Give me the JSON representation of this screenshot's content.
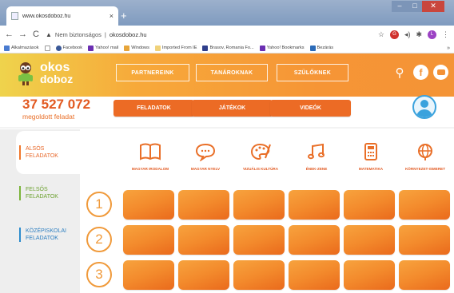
{
  "browser": {
    "tab_title": "www.okosdoboz.hu",
    "tab_close": "×",
    "new_tab": "+",
    "window_min": "–",
    "window_max": "□",
    "window_close": "✕",
    "back_icon": "←",
    "forward_icon": "→",
    "reload_icon": "C",
    "security_warning": "Nem biztonságos",
    "url": "okosdoboz.hu",
    "star_icon": "☆",
    "profile_g": "G",
    "profile_l": "L",
    "menu_icon": "⋮",
    "bookmarks": [
      {
        "label": "Alkalmazások",
        "color": "#4a7bd0"
      },
      {
        "label": "Facebook",
        "color": "#3b5998"
      },
      {
        "label": "Yahoo! mail",
        "color": "#6b2fb2"
      },
      {
        "label": "Windows",
        "color": "#e7a53a"
      },
      {
        "label": "Imported From IE",
        "color": "#f0d27a"
      },
      {
        "label": "Brasov, Romania Fo...",
        "color": "#2f3f8c"
      },
      {
        "label": "Yahoo! Bookmarks",
        "color": "#6b2fb2"
      },
      {
        "label": "Bezárás",
        "color": "#2b6bb8"
      }
    ],
    "bookmarks_more": "»"
  },
  "site": {
    "logo_line1": "okos",
    "logo_line2": "doboz",
    "nav": [
      "PARTNEREINK",
      "TANÁROKNAK",
      "SZÜLŐKNEK"
    ],
    "counter_number": "37 527 072",
    "counter_label": "megoldott feladat",
    "tabs": [
      "FELADATOK",
      "JÁTÉKOK",
      "VIDEÓK"
    ],
    "sidebar": [
      "ALSÓS FELADATOK",
      "FELSŐS FELADATOK",
      "KÖZÉPISKOLAI FELADATOK"
    ],
    "subjects": [
      {
        "label": "MAGYAR IRODALOM",
        "icon": "book-icon"
      },
      {
        "label": "MAGYAR NYELV",
        "icon": "speech-bubble-icon"
      },
      {
        "label": "VIZUÁLIS KULTÚRA",
        "icon": "palette-icon"
      },
      {
        "label": "ÉNEK-ZENE",
        "icon": "music-note-icon"
      },
      {
        "label": "MATEMATIKA",
        "icon": "calculator-icon"
      },
      {
        "label": "KÖRNYEZET-ISMERET",
        "icon": "globe-icon"
      }
    ],
    "grades": [
      "1",
      "2",
      "3"
    ],
    "colors": {
      "orange": "#ec6b25",
      "header_start": "#efd34c",
      "header_end": "#f49436",
      "blue": "#2c8ccd",
      "green": "#7bb43a"
    }
  }
}
